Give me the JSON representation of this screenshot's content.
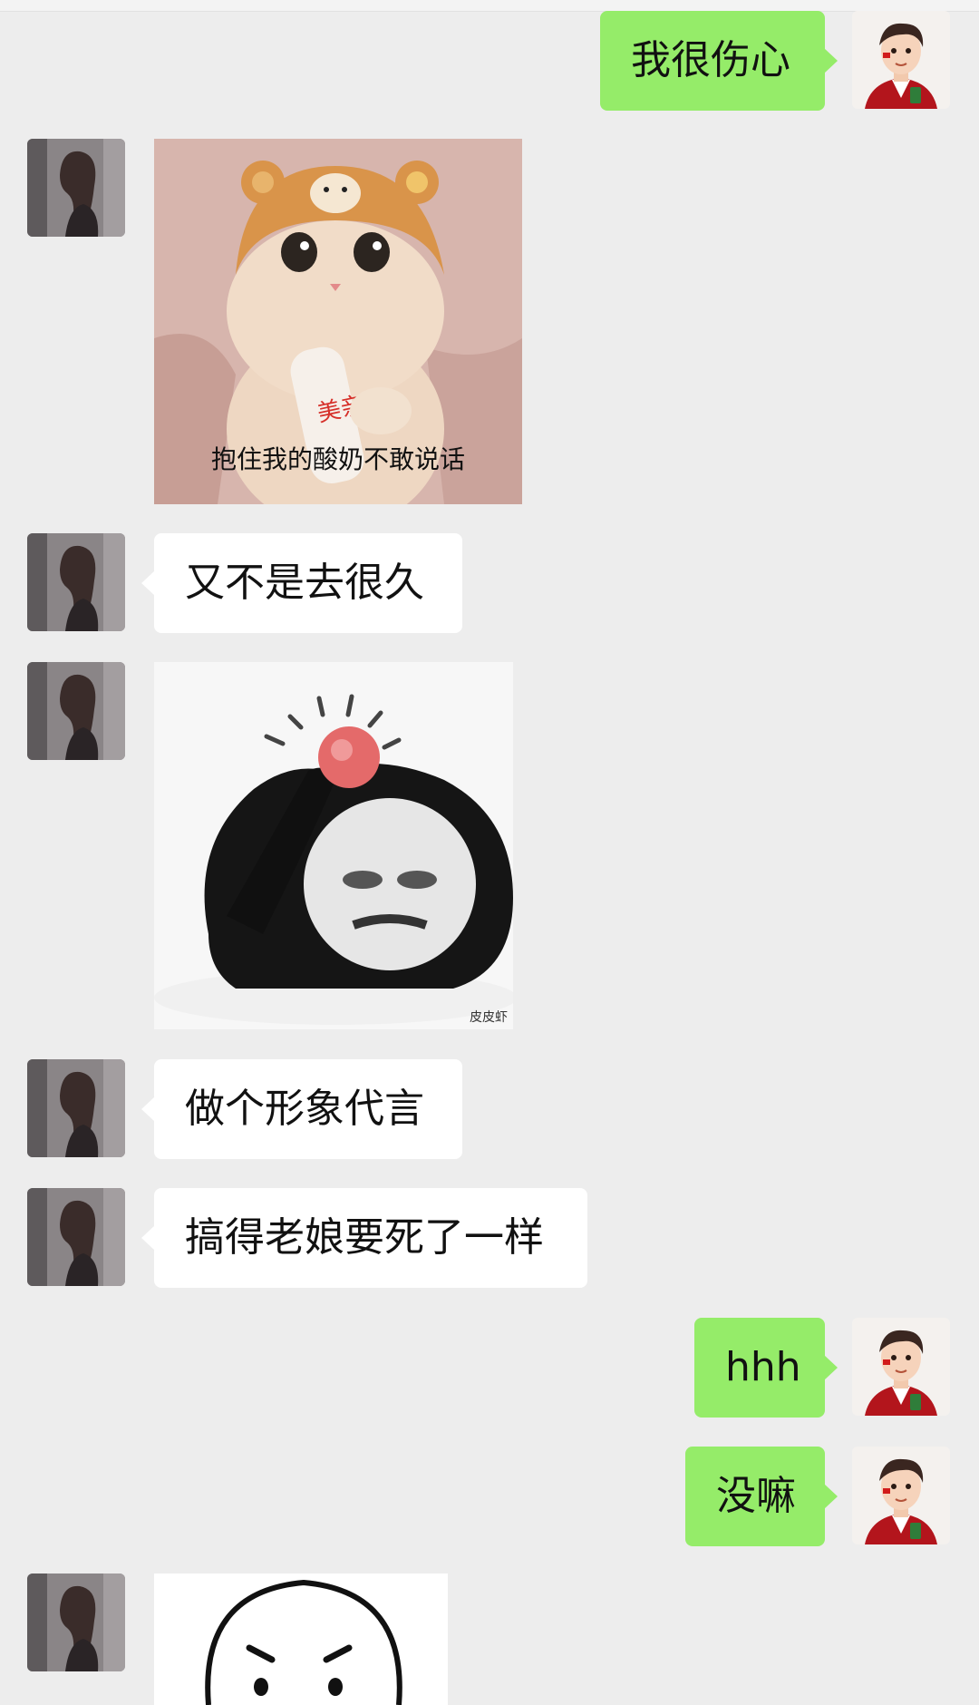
{
  "messages": [
    {
      "id": "m1",
      "side": "out",
      "type": "text",
      "text": "我很伤心"
    },
    {
      "id": "m2",
      "side": "in",
      "type": "sticker",
      "sticker": "cat-bear-hat-yogurt",
      "caption": "抱住我的酸奶不敢说话",
      "bottle_text": "美亲"
    },
    {
      "id": "m3",
      "side": "in",
      "type": "text",
      "text": "又不是去很久"
    },
    {
      "id": "m4",
      "side": "in",
      "type": "sticker",
      "sticker": "panda-head-bump",
      "watermark": "皮皮虾"
    },
    {
      "id": "m5",
      "side": "in",
      "type": "text",
      "text": "做个形象代言"
    },
    {
      "id": "m6",
      "side": "in",
      "type": "text",
      "text": "搞得老娘要死了一样"
    },
    {
      "id": "m7",
      "side": "out",
      "type": "text",
      "text": "hhh"
    },
    {
      "id": "m8",
      "side": "out",
      "type": "text",
      "text": "没嘛"
    },
    {
      "id": "m9",
      "side": "in",
      "type": "sticker",
      "sticker": "angry-round-face"
    }
  ],
  "avatars": {
    "me": "avatar-cartoon-boy-red-jacket",
    "contact": "avatar-woman-photo"
  },
  "colors": {
    "background": "#ededed",
    "outgoing_bubble": "#95ec69",
    "incoming_bubble": "#ffffff"
  }
}
